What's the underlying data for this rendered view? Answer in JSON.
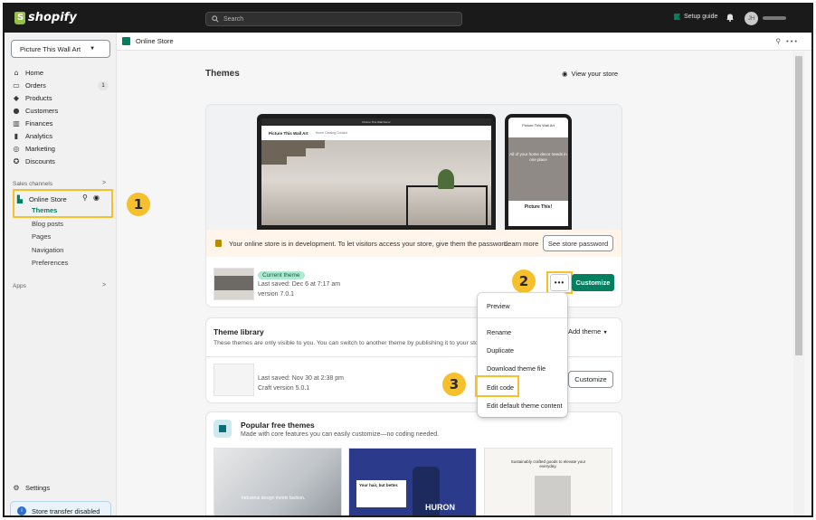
{
  "topbar": {
    "logo_text": "shopify",
    "search_placeholder": "Search",
    "setup_guide": "Setup guide",
    "avatar_initials": "JH"
  },
  "sidebar": {
    "store_name": "Picture This Wall Art",
    "items": [
      {
        "label": "Home",
        "icon": "home-icon"
      },
      {
        "label": "Orders",
        "icon": "orders-icon",
        "badge": "1"
      },
      {
        "label": "Products",
        "icon": "products-icon"
      },
      {
        "label": "Customers",
        "icon": "customers-icon"
      },
      {
        "label": "Finances",
        "icon": "finances-icon"
      },
      {
        "label": "Analytics",
        "icon": "analytics-icon"
      },
      {
        "label": "Marketing",
        "icon": "marketing-icon"
      },
      {
        "label": "Discounts",
        "icon": "discounts-icon"
      }
    ],
    "sales_channels_label": "Sales channels",
    "online_store": "Online Store",
    "online_store_sub": [
      "Themes",
      "Blog posts",
      "Pages",
      "Navigation",
      "Preferences"
    ],
    "apps_label": "Apps",
    "settings": "Settings",
    "store_transfer": "Store transfer disabled"
  },
  "breadcrumb": {
    "label": "Online Store"
  },
  "markers": [
    "1",
    "2",
    "3"
  ],
  "main": {
    "title": "Themes",
    "view_store": "View your store",
    "current_theme": {
      "desktop_topline": "Picture This Wall Decor",
      "desktop_brand": "Picture This Wall Art",
      "desktop_links": "Home  Catalog  Contact",
      "phone_brand": "Picture This Wall Art",
      "phone_hero": "All of your home decor needs in one place",
      "phone_title": "Picture This!",
      "dev_notice": "Your online store is in development. To let visitors access your store, give them the password.",
      "learn_more": "Learn more",
      "see_password": "See store password",
      "badge": "Current theme",
      "last_saved": "Last saved: Dec 6 at 7:17 am",
      "version": "version 7.0.1",
      "dots": "•••",
      "customize": "Customize"
    },
    "library": {
      "title": "Theme library",
      "desc": "These themes are only visible to you. You can switch to another theme by publishing it to your sto",
      "add_theme": "Add theme",
      "last_saved": "Last saved: Nov 30 at 2:38 pm",
      "version": "Craft version 5.0.1",
      "customize": "Customize"
    },
    "popular": {
      "title": "Popular free themes",
      "desc": "Made with core features you can easily customize—no coding needed.",
      "thumb1_caption": "Industrial design meets fashion.",
      "thumb2_caption": "Your hair, but better.",
      "thumb2_brand": "HURON",
      "thumb3_caption": "Sustainably crafted goods to elevate your everyday."
    }
  },
  "menu": {
    "items": [
      "Preview",
      "Rename",
      "Duplicate",
      "Download theme file",
      "Edit code",
      "Edit default theme content"
    ]
  },
  "colors": {
    "accent_green": "#008060",
    "highlight": "#f5c02c",
    "topbar": "#1a1a1a"
  }
}
